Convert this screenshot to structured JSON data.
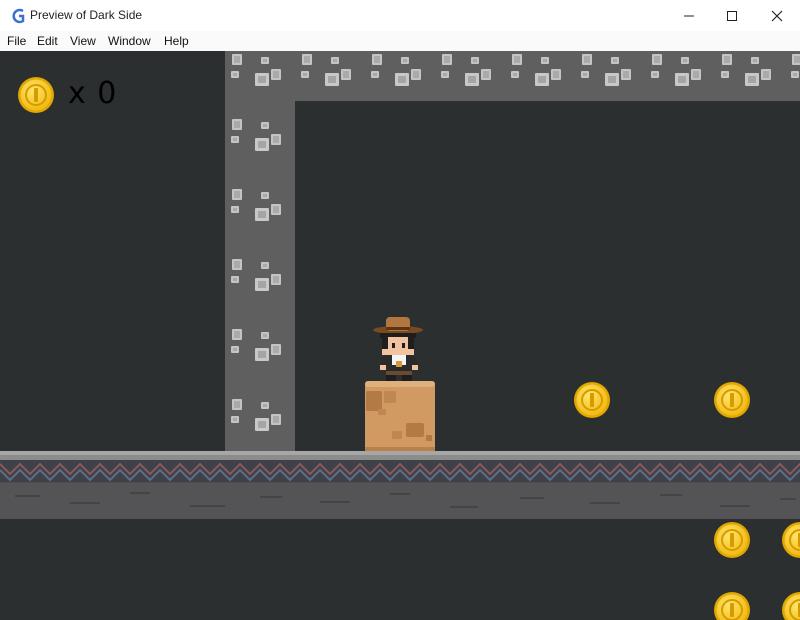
{
  "window": {
    "title": "Preview of Dark Side",
    "controls": [
      "minimize",
      "maximize",
      "close"
    ]
  },
  "menu": {
    "items": [
      {
        "label": "File"
      },
      {
        "label": "Edit"
      },
      {
        "label": "View"
      },
      {
        "label": "Window"
      },
      {
        "label": "Help"
      }
    ]
  },
  "hud": {
    "coin_icon": "coin-icon",
    "coin_count": "x 0"
  },
  "scene": {
    "player": "cowboy-hat-explorer",
    "crate": "dirt-block",
    "terrain": [
      "stone-pillar",
      "stone-ceiling",
      "stone-floor"
    ],
    "coins_visible": 6,
    "colors": {
      "background": "#2b2f2f",
      "stone": "#5f5f5f",
      "coin": "#f5c518",
      "crate": "#d09a62"
    }
  }
}
